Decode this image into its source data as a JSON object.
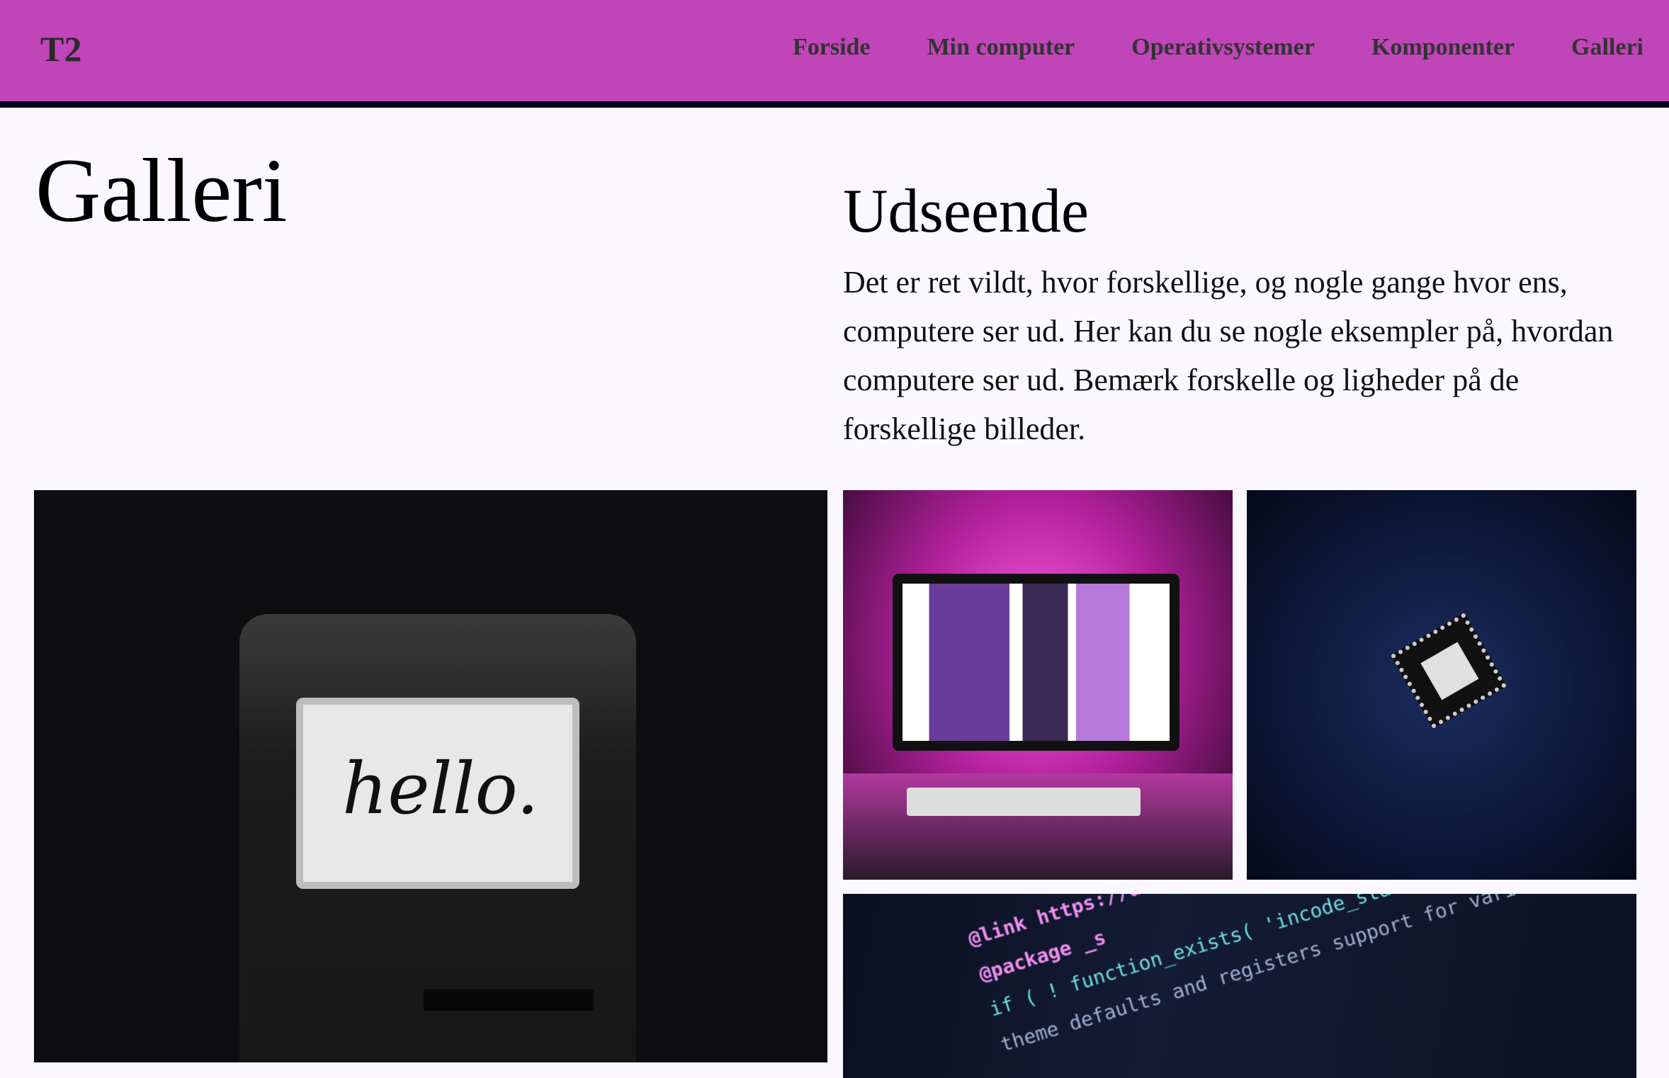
{
  "header": {
    "logo": "T2",
    "nav": [
      "Forside",
      "Min computer",
      "Operativsystemer",
      "Komponenter",
      "Galleri"
    ]
  },
  "page": {
    "title": "Galleri",
    "section_title": "Udseende",
    "intro": "Det er ret vildt, hvor forskellige, og nogle gange hvor ens, computere ser ud. Her kan du se nogle eksempler på, hvordan computere ser ud. Bemærk forskelle og ligheder på de forskellige billeder."
  },
  "gallery": {
    "mac_screen_text": "hello.",
    "code_lines": [
      "@link https://developer",
      "@package _s",
      "if ( ! function_exists( 'incode_starter_setup' ) ) :",
      "theme defaults and registers support for various WordPress features"
    ]
  },
  "colors": {
    "header": "#c045b8",
    "header_border": "#000020",
    "background": "#faf8fe"
  }
}
